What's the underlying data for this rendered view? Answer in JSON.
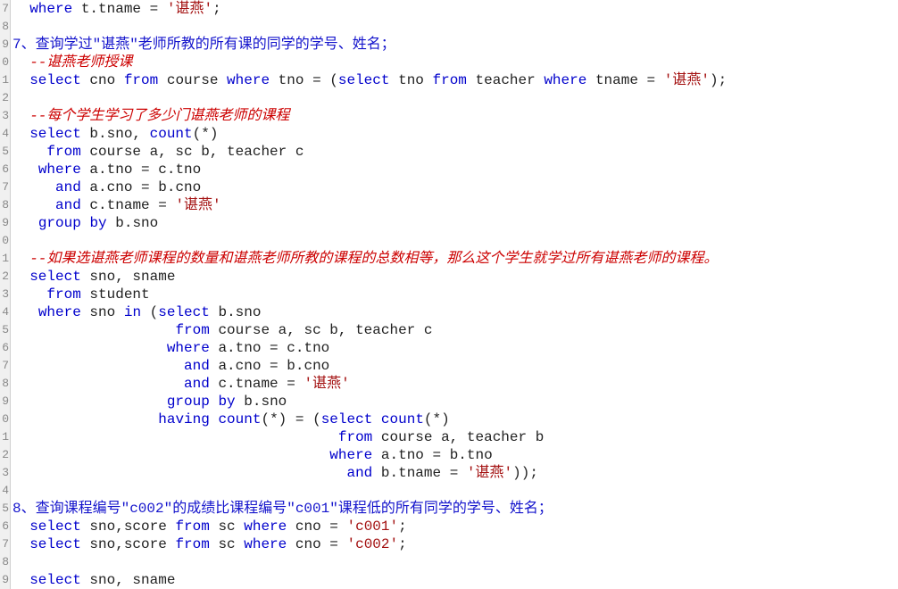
{
  "startLine": 7,
  "lines": [
    {
      "n": "7",
      "segs": [
        {
          "c": "plain",
          "t": "  "
        },
        {
          "c": "kw",
          "t": "where"
        },
        {
          "c": "plain",
          "t": " t.tname = "
        },
        {
          "c": "str",
          "t": "'谌燕'"
        },
        {
          "c": "plain",
          "t": ";"
        }
      ]
    },
    {
      "n": "8",
      "segs": []
    },
    {
      "n": "9",
      "segs": [
        {
          "c": "prob",
          "t": "7、查询学过\"谌燕\"老师所教的所有课的同学的学号、姓名；"
        }
      ]
    },
    {
      "n": "0",
      "segs": [
        {
          "c": "plain",
          "t": "  "
        },
        {
          "c": "cmt",
          "t": "--谌燕老师授课"
        }
      ]
    },
    {
      "n": "1",
      "segs": [
        {
          "c": "plain",
          "t": "  "
        },
        {
          "c": "kw",
          "t": "select"
        },
        {
          "c": "plain",
          "t": " cno "
        },
        {
          "c": "kw",
          "t": "from"
        },
        {
          "c": "plain",
          "t": " course "
        },
        {
          "c": "kw",
          "t": "where"
        },
        {
          "c": "plain",
          "t": " tno = ("
        },
        {
          "c": "kw",
          "t": "select"
        },
        {
          "c": "plain",
          "t": " tno "
        },
        {
          "c": "kw",
          "t": "from"
        },
        {
          "c": "plain",
          "t": " teacher "
        },
        {
          "c": "kw",
          "t": "where"
        },
        {
          "c": "plain",
          "t": " tname = "
        },
        {
          "c": "str",
          "t": "'谌燕'"
        },
        {
          "c": "plain",
          "t": ");"
        }
      ]
    },
    {
      "n": "2",
      "segs": []
    },
    {
      "n": "3",
      "segs": [
        {
          "c": "plain",
          "t": "  "
        },
        {
          "c": "cmt",
          "t": "--每个学生学习了多少门谌燕老师的课程"
        }
      ]
    },
    {
      "n": "4",
      "segs": [
        {
          "c": "plain",
          "t": "  "
        },
        {
          "c": "kw",
          "t": "select"
        },
        {
          "c": "plain",
          "t": " b.sno, "
        },
        {
          "c": "kw",
          "t": "count"
        },
        {
          "c": "plain",
          "t": "(*)"
        }
      ]
    },
    {
      "n": "5",
      "segs": [
        {
          "c": "plain",
          "t": "    "
        },
        {
          "c": "kw",
          "t": "from"
        },
        {
          "c": "plain",
          "t": " course a, sc b, teacher c"
        }
      ]
    },
    {
      "n": "6",
      "segs": [
        {
          "c": "plain",
          "t": "   "
        },
        {
          "c": "kw",
          "t": "where"
        },
        {
          "c": "plain",
          "t": " a.tno = c.tno"
        }
      ]
    },
    {
      "n": "7",
      "segs": [
        {
          "c": "plain",
          "t": "     "
        },
        {
          "c": "kw",
          "t": "and"
        },
        {
          "c": "plain",
          "t": " a.cno = b.cno"
        }
      ]
    },
    {
      "n": "8",
      "segs": [
        {
          "c": "plain",
          "t": "     "
        },
        {
          "c": "kw",
          "t": "and"
        },
        {
          "c": "plain",
          "t": " c.tname = "
        },
        {
          "c": "str",
          "t": "'谌燕'"
        }
      ]
    },
    {
      "n": "9",
      "segs": [
        {
          "c": "plain",
          "t": "   "
        },
        {
          "c": "kw",
          "t": "group"
        },
        {
          "c": "plain",
          "t": " "
        },
        {
          "c": "kw",
          "t": "by"
        },
        {
          "c": "plain",
          "t": " b.sno"
        }
      ]
    },
    {
      "n": "0",
      "segs": []
    },
    {
      "n": "1",
      "segs": [
        {
          "c": "plain",
          "t": "  "
        },
        {
          "c": "cmt",
          "t": "--如果选谌燕老师课程的数量和谌燕老师所教的课程的总数相等，那么这个学生就学过所有谌燕老师的课程。"
        }
      ]
    },
    {
      "n": "2",
      "segs": [
        {
          "c": "plain",
          "t": "  "
        },
        {
          "c": "kw",
          "t": "select"
        },
        {
          "c": "plain",
          "t": " sno, sname"
        }
      ]
    },
    {
      "n": "3",
      "segs": [
        {
          "c": "plain",
          "t": "    "
        },
        {
          "c": "kw",
          "t": "from"
        },
        {
          "c": "plain",
          "t": " student"
        }
      ]
    },
    {
      "n": "4",
      "segs": [
        {
          "c": "plain",
          "t": "   "
        },
        {
          "c": "kw",
          "t": "where"
        },
        {
          "c": "plain",
          "t": " sno "
        },
        {
          "c": "kw",
          "t": "in"
        },
        {
          "c": "plain",
          "t": " ("
        },
        {
          "c": "kw",
          "t": "select"
        },
        {
          "c": "plain",
          "t": " b.sno"
        }
      ]
    },
    {
      "n": "5",
      "segs": [
        {
          "c": "plain",
          "t": "                   "
        },
        {
          "c": "kw",
          "t": "from"
        },
        {
          "c": "plain",
          "t": " course a, sc b, teacher c"
        }
      ]
    },
    {
      "n": "6",
      "segs": [
        {
          "c": "plain",
          "t": "                  "
        },
        {
          "c": "kw",
          "t": "where"
        },
        {
          "c": "plain",
          "t": " a.tno = c.tno"
        }
      ]
    },
    {
      "n": "7",
      "segs": [
        {
          "c": "plain",
          "t": "                    "
        },
        {
          "c": "kw",
          "t": "and"
        },
        {
          "c": "plain",
          "t": " a.cno = b.cno"
        }
      ]
    },
    {
      "n": "8",
      "segs": [
        {
          "c": "plain",
          "t": "                    "
        },
        {
          "c": "kw",
          "t": "and"
        },
        {
          "c": "plain",
          "t": " c.tname = "
        },
        {
          "c": "str",
          "t": "'谌燕'"
        }
      ]
    },
    {
      "n": "9",
      "segs": [
        {
          "c": "plain",
          "t": "                  "
        },
        {
          "c": "kw",
          "t": "group"
        },
        {
          "c": "plain",
          "t": " "
        },
        {
          "c": "kw",
          "t": "by"
        },
        {
          "c": "plain",
          "t": " b.sno"
        }
      ]
    },
    {
      "n": "0",
      "segs": [
        {
          "c": "plain",
          "t": "                 "
        },
        {
          "c": "kw",
          "t": "having"
        },
        {
          "c": "plain",
          "t": " "
        },
        {
          "c": "kw",
          "t": "count"
        },
        {
          "c": "plain",
          "t": "(*) = ("
        },
        {
          "c": "kw",
          "t": "select"
        },
        {
          "c": "plain",
          "t": " "
        },
        {
          "c": "kw",
          "t": "count"
        },
        {
          "c": "plain",
          "t": "(*)"
        }
      ]
    },
    {
      "n": "1",
      "segs": [
        {
          "c": "plain",
          "t": "                                      "
        },
        {
          "c": "kw",
          "t": "from"
        },
        {
          "c": "plain",
          "t": " course a, teacher b"
        }
      ]
    },
    {
      "n": "2",
      "segs": [
        {
          "c": "plain",
          "t": "                                     "
        },
        {
          "c": "kw",
          "t": "where"
        },
        {
          "c": "plain",
          "t": " a.tno = b.tno"
        }
      ]
    },
    {
      "n": "3",
      "segs": [
        {
          "c": "plain",
          "t": "                                       "
        },
        {
          "c": "kw",
          "t": "and"
        },
        {
          "c": "plain",
          "t": " b.tname = "
        },
        {
          "c": "str",
          "t": "'谌燕'"
        },
        {
          "c": "plain",
          "t": "));"
        }
      ]
    },
    {
      "n": "4",
      "segs": []
    },
    {
      "n": "5",
      "segs": [
        {
          "c": "prob",
          "t": "8、查询课程编号\"c002\"的成绩比课程编号\"c001\"课程低的所有同学的学号、姓名；"
        }
      ]
    },
    {
      "n": "6",
      "segs": [
        {
          "c": "plain",
          "t": "  "
        },
        {
          "c": "kw",
          "t": "select"
        },
        {
          "c": "plain",
          "t": " sno,score "
        },
        {
          "c": "kw",
          "t": "from"
        },
        {
          "c": "plain",
          "t": " sc "
        },
        {
          "c": "kw",
          "t": "where"
        },
        {
          "c": "plain",
          "t": " cno = "
        },
        {
          "c": "str",
          "t": "'c001'"
        },
        {
          "c": "plain",
          "t": ";"
        }
      ]
    },
    {
      "n": "7",
      "segs": [
        {
          "c": "plain",
          "t": "  "
        },
        {
          "c": "kw",
          "t": "select"
        },
        {
          "c": "plain",
          "t": " sno,score "
        },
        {
          "c": "kw",
          "t": "from"
        },
        {
          "c": "plain",
          "t": " sc "
        },
        {
          "c": "kw",
          "t": "where"
        },
        {
          "c": "plain",
          "t": " cno = "
        },
        {
          "c": "str",
          "t": "'c002'"
        },
        {
          "c": "plain",
          "t": ";"
        }
      ]
    },
    {
      "n": "8",
      "segs": []
    },
    {
      "n": "9",
      "segs": [
        {
          "c": "plain",
          "t": "  "
        },
        {
          "c": "kw",
          "t": "select"
        },
        {
          "c": "plain",
          "t": " sno, sname"
        }
      ]
    }
  ]
}
